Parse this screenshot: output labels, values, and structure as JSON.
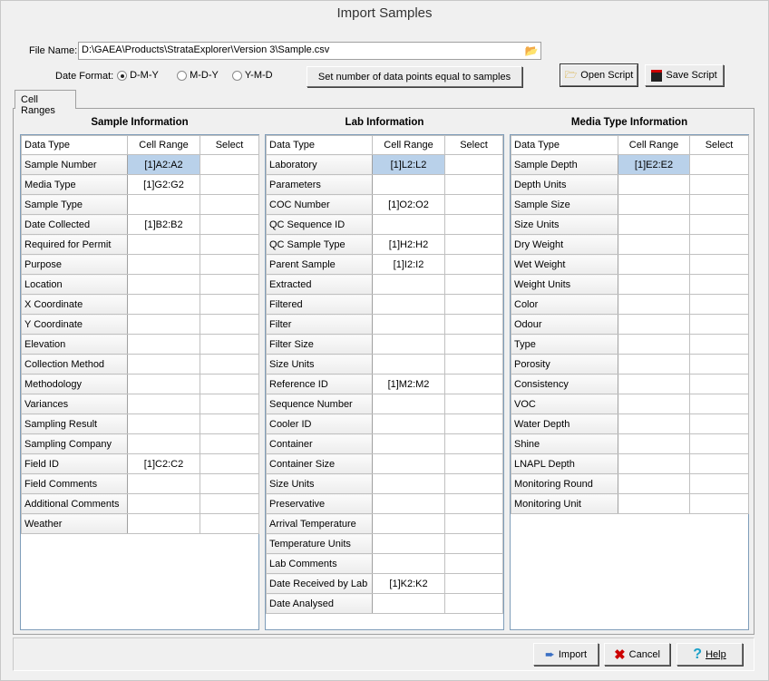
{
  "window": {
    "title": "Import Samples"
  },
  "file": {
    "label": "File Name:",
    "value": "D:\\GAEA\\Products\\StrataExplorer\\Version 3\\Sample.csv"
  },
  "date_format": {
    "label": "Date Format:",
    "options": [
      "D-M-Y",
      "M-D-Y",
      "Y-M-D"
    ],
    "selected": "D-M-Y"
  },
  "buttons": {
    "set_points": "Set number of data points equal to samples",
    "open_script": "Open Script",
    "save_script": "Save Script",
    "import": "Import",
    "cancel": "Cancel",
    "help": "Help"
  },
  "tabs": [
    {
      "label": "Cell Ranges",
      "active": true
    }
  ],
  "columns": [
    "Data Type",
    "Cell Range",
    "Select"
  ],
  "sections": [
    {
      "title": "Sample Information",
      "rows": [
        [
          "Sample Number",
          "[1]A2:A2"
        ],
        [
          "Media Type",
          "[1]G2:G2"
        ],
        [
          "Sample Type",
          ""
        ],
        [
          "Date Collected",
          "[1]B2:B2"
        ],
        [
          "Required for Permit",
          ""
        ],
        [
          "Purpose",
          ""
        ],
        [
          "Location",
          ""
        ],
        [
          "X Coordinate",
          ""
        ],
        [
          "Y Coordinate",
          ""
        ],
        [
          "Elevation",
          ""
        ],
        [
          "Collection Method",
          ""
        ],
        [
          "Methodology",
          ""
        ],
        [
          "Variances",
          ""
        ],
        [
          "Sampling Result",
          ""
        ],
        [
          "Sampling Company",
          ""
        ],
        [
          "Field ID",
          "[1]C2:C2"
        ],
        [
          "Field Comments",
          ""
        ],
        [
          "Additional Comments",
          ""
        ],
        [
          "Weather",
          ""
        ]
      ]
    },
    {
      "title": "Lab Information",
      "rows": [
        [
          "Laboratory",
          "[1]L2:L2"
        ],
        [
          "Parameters",
          ""
        ],
        [
          "COC Number",
          "[1]O2:O2"
        ],
        [
          "QC Sequence ID",
          ""
        ],
        [
          "QC Sample Type",
          "[1]H2:H2"
        ],
        [
          "Parent Sample",
          "[1]I2:I2"
        ],
        [
          "Extracted",
          ""
        ],
        [
          "Filtered",
          ""
        ],
        [
          "Filter",
          ""
        ],
        [
          "Filter Size",
          ""
        ],
        [
          "Size Units",
          ""
        ],
        [
          "Reference ID",
          "[1]M2:M2"
        ],
        [
          "Sequence Number",
          ""
        ],
        [
          "Cooler ID",
          ""
        ],
        [
          "Container",
          ""
        ],
        [
          "Container Size",
          ""
        ],
        [
          "Size Units",
          ""
        ],
        [
          "Preservative",
          ""
        ],
        [
          "Arrival Temperature",
          ""
        ],
        [
          "Temperature Units",
          ""
        ],
        [
          "Lab Comments",
          ""
        ],
        [
          "Date Received by Lab",
          "[1]K2:K2"
        ],
        [
          "Date Analysed",
          ""
        ]
      ]
    },
    {
      "title": "Media Type Information",
      "rows": [
        [
          "Sample Depth",
          "[1]E2:E2"
        ],
        [
          "Depth Units",
          ""
        ],
        [
          "Sample Size",
          ""
        ],
        [
          "Size Units",
          ""
        ],
        [
          "Dry Weight",
          ""
        ],
        [
          "Wet Weight",
          ""
        ],
        [
          "Weight Units",
          ""
        ],
        [
          "Color",
          ""
        ],
        [
          "Odour",
          ""
        ],
        [
          "Type",
          ""
        ],
        [
          "Porosity",
          ""
        ],
        [
          "Consistency",
          ""
        ],
        [
          "VOC",
          ""
        ],
        [
          "Water Depth",
          ""
        ],
        [
          "Shine",
          ""
        ],
        [
          "LNAPL Depth",
          ""
        ],
        [
          "Monitoring Round",
          ""
        ],
        [
          "Monitoring Unit",
          ""
        ]
      ]
    }
  ],
  "colors": {
    "selected_cell": "#b9d1ea",
    "grid_border": "#7f9db9"
  }
}
